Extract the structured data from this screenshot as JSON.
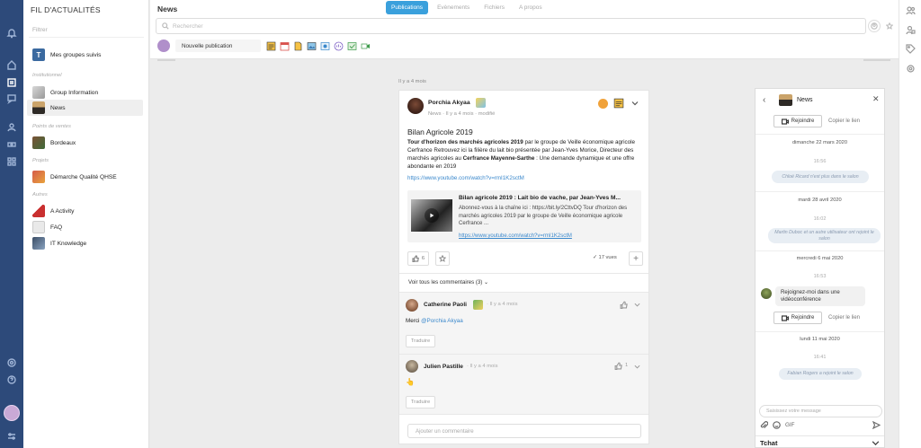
{
  "sidebar": {
    "title": "FIL D'ACTUALITÉS",
    "filter_placeholder": "Filtrer",
    "followed": "Mes groupes suivis",
    "sections": {
      "institutionnel": "Institutionnel",
      "points_de_vente": "Points de ventes",
      "projets": "Projets",
      "autres": "Autres"
    },
    "items": {
      "group_information": "Group Information",
      "news": "News",
      "bordeaux": "Bordeaux",
      "qhse": "Démarche Qualité QHSE",
      "activity": "A Activity",
      "faq": "FAQ",
      "it_knowledge": "IT Knowledge"
    }
  },
  "header": {
    "title": "News",
    "tabs": [
      "Publications",
      "Evènements",
      "Fichiers",
      "A propos"
    ],
    "active_tab": "Publications",
    "search_placeholder": "Rechercher",
    "new_post": "Nouvelle publication"
  },
  "feed": {
    "date_separator": "Il y a 4 mois",
    "post": {
      "author": "Porchia Akyaa",
      "meta": "News · Il y a 4 mois · modifié",
      "title": "Bilan Agricole 2019",
      "body_part1": "Tour d'horizon des marchés agricoles 2019",
      "body_part2": " par le groupe de Veille économique agricole Cerfrance Retrouvez ici la filière du lait bio présentée par Jean-Yves Morice, Directeur des marchés agricoles au ",
      "body_part3": "Cerfrance Mayenne-Sarthe",
      "body_part4": " : Une demande dynamique et une offre abondante en 2019",
      "link": "https://www.youtube.com/watch?v=rmI1K2sctM",
      "preview": {
        "title": "Bilan agricole 2019 : Lait bio de vache, par Jean-Yves M...",
        "description": "Abonnez-vous à la chaîne ici : https://bit.ly/2CttvDQ Tour d'horizon des marchés agricoles 2019 par le groupe de Veille économique agricole Cerfrance ...",
        "link": "https://www.youtube.com/watch?v=rmI1K2sctM"
      },
      "likes": "6",
      "views": "17 vues",
      "comments_toggle": "Voir tous les commentaires (3)"
    },
    "comments": [
      {
        "author": "Catherine Paoli",
        "time": "· Il y a 4 mois",
        "text_prefix": "Merci ",
        "mention": "@Porchia Akyaa",
        "translate": "Traduire"
      },
      {
        "author": "Julien Pastille",
        "time": "· Il y a 4 mois",
        "text": "👆",
        "likes": "1",
        "translate": "Traduire"
      }
    ],
    "add_comment_placeholder": "Ajouter un commentaire"
  },
  "chat": {
    "title": "News",
    "join": "Rejoindre",
    "copy_link": "Copier le lien",
    "timeline": [
      {
        "date": "dimanche 22 mars 2020",
        "time": "16:56",
        "system": "Chloé Ricard n'est plus dans le salon"
      },
      {
        "date": "mardi 28 avril 2020",
        "time": "16:02",
        "system": "Martin Duboc et un autre utilisateur ont rejoint le salon"
      },
      {
        "date": "mercredi 6 mai 2020",
        "time": "16:53",
        "message": "Rejoignez-moi dans une vidéoconférence"
      },
      {
        "date": "lundi 11 mai 2020",
        "time": "16:41",
        "system": "Fabian Rogers a rejoint le salon"
      }
    ],
    "input_placeholder": "Saisissez votre message",
    "gif": "GIF",
    "footer": "Tchat"
  },
  "colors": {
    "rail": "#2d4a7a",
    "accent": "#3aa0dc",
    "link": "#3a88cc"
  }
}
